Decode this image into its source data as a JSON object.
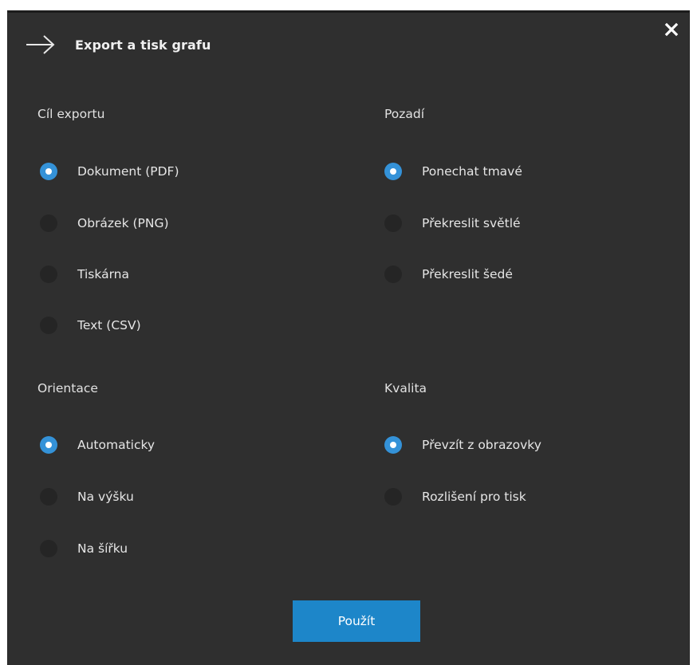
{
  "dialog": {
    "title": "Export a tisk grafu",
    "icons": {
      "back": "arrow-right-icon",
      "close": "close-icon"
    }
  },
  "export_target": {
    "heading": "Cíl exportu",
    "selected": "Dokument (PDF)",
    "options": [
      {
        "label": "Dokument (PDF)",
        "checked": true
      },
      {
        "label": "Obrázek (PNG)",
        "checked": false
      },
      {
        "label": "Tiskárna",
        "checked": false
      },
      {
        "label": "Text (CSV)",
        "checked": false
      }
    ]
  },
  "background": {
    "heading": "Pozadí",
    "selected": "Ponechat tmavé",
    "options": [
      {
        "label": "Ponechat tmavé",
        "checked": true
      },
      {
        "label": "Překreslit světlé",
        "checked": false
      },
      {
        "label": "Překreslit šedé",
        "checked": false
      }
    ]
  },
  "orientation": {
    "heading": "Orientace",
    "selected": "Automaticky",
    "options": [
      {
        "label": "Automaticky",
        "checked": true
      },
      {
        "label": "Na výšku",
        "checked": false
      },
      {
        "label": "Na šířku",
        "checked": false
      }
    ]
  },
  "quality": {
    "heading": "Kvalita",
    "selected": "Převzít z obrazovky",
    "options": [
      {
        "label": "Převzít z obrazovky",
        "checked": true
      },
      {
        "label": "Rozlišení pro tisk",
        "checked": false
      }
    ]
  },
  "actions": {
    "apply_label": "Použít"
  },
  "colors": {
    "background": "#2f2f2f",
    "accent": "#3492d8",
    "button": "#1d86c9",
    "radio_unchecked": "#252525"
  }
}
